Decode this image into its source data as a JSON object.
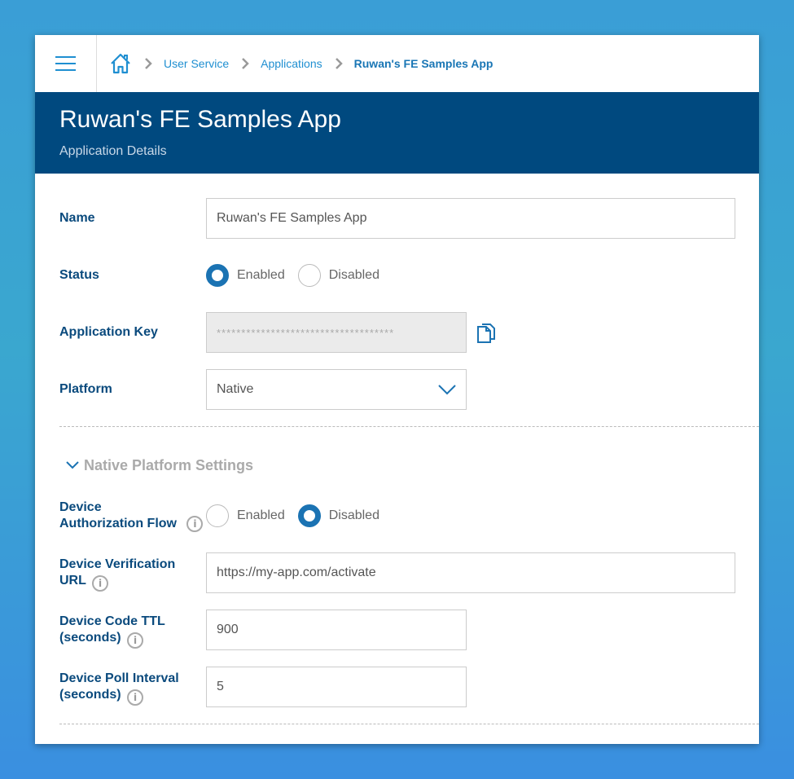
{
  "breadcrumb": {
    "items": [
      "User Service",
      "Applications"
    ],
    "current": "Ruwan's FE Samples App"
  },
  "header": {
    "title": "Ruwan's FE Samples App",
    "subtitle": "Application Details"
  },
  "form": {
    "name": {
      "label": "Name",
      "value": "Ruwan's FE Samples App"
    },
    "status": {
      "label": "Status",
      "options": [
        "Enabled",
        "Disabled"
      ],
      "selected": "Enabled"
    },
    "application_key": {
      "label": "Application Key",
      "value": "************************************"
    },
    "platform": {
      "label": "Platform",
      "value": "Native"
    }
  },
  "native_settings": {
    "section_title": "Native Platform Settings",
    "device_auth_flow": {
      "label": "Device Authorization Flow",
      "options": [
        "Enabled",
        "Disabled"
      ],
      "selected": "Disabled"
    },
    "verification_url": {
      "label": "Device Verification URL",
      "value": "https://my-app.com/activate"
    },
    "code_ttl": {
      "label": "Device Code TTL (seconds)",
      "value": "900"
    },
    "poll_interval": {
      "label": "Device Poll Interval (seconds)",
      "value": "5"
    }
  },
  "icons": {
    "menu": "hamburger-icon",
    "home": "home-icon",
    "separator": "chevron-right-icon",
    "copy": "copy-icon",
    "dropdown": "chevron-down-icon",
    "collapse": "chevron-down-icon",
    "info": "info-icon"
  },
  "colors": {
    "banner": "#00497f",
    "accent": "#1b73b3",
    "link": "#1f8fd1",
    "label": "#0a4a7d"
  }
}
